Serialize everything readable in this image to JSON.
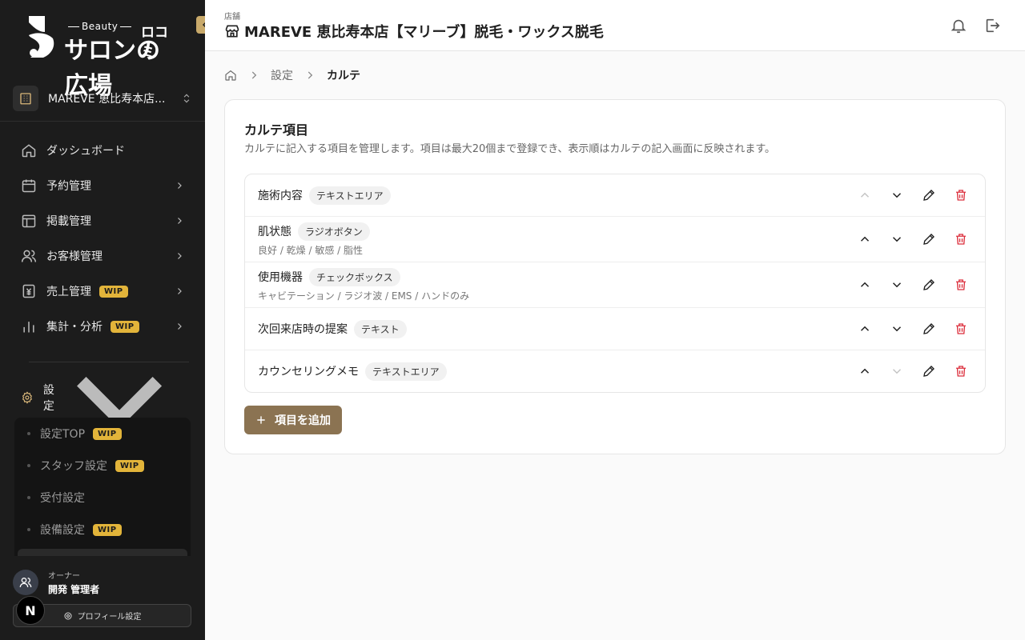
{
  "sidebar": {
    "logo": {
      "beauty": "Beauty",
      "kuchikomi": "ロコミ",
      "name": "サロンの広場"
    },
    "store": {
      "name": "MAREVE 恵比寿本店..."
    },
    "nav": [
      {
        "label": "ダッシュボード",
        "icon": "home-icon",
        "wip": ""
      },
      {
        "label": "予約管理",
        "icon": "calendar-icon",
        "wip": ""
      },
      {
        "label": "掲載管理",
        "icon": "layout-icon",
        "wip": ""
      },
      {
        "label": "お客様管理",
        "icon": "users-icon",
        "wip": ""
      },
      {
        "label": "売上管理",
        "icon": "money-icon",
        "wip": "WIP"
      },
      {
        "label": "集計・分析",
        "icon": "bar-chart-icon",
        "wip": "WIP"
      }
    ],
    "settings": {
      "label": "設定",
      "items": [
        {
          "label": "設定TOP",
          "wip": "WIP"
        },
        {
          "label": "スタッフ設定",
          "wip": "WIP"
        },
        {
          "label": "受付設定",
          "wip": ""
        },
        {
          "label": "設備設定",
          "wip": "WIP"
        }
      ]
    },
    "user": {
      "role": "オーナー",
      "name": "開発 管理者"
    },
    "n_badge": "N",
    "profile_button": "プロフィール設定"
  },
  "header": {
    "label": "店舗",
    "title": "MAREVE 恵比寿本店【マリーブ】脱毛・ワックス脱毛"
  },
  "breadcrumb": {
    "settings": "設定",
    "current": "カルテ"
  },
  "card": {
    "title": "カルテ項目",
    "description": "カルテに記入する項目を管理します。項目は最大20個まで登録でき、表示順はカルテの記入画面に反映されます。",
    "items": [
      {
        "name": "施術内容",
        "type": "テキストエリア",
        "options": "",
        "up_enabled": false,
        "down_enabled": true
      },
      {
        "name": "肌状態",
        "type": "ラジオボタン",
        "options": "良好 / 乾燥 / 敏感 / 脂性",
        "up_enabled": true,
        "down_enabled": true
      },
      {
        "name": "使用機器",
        "type": "チェックボックス",
        "options": "キャビテーション / ラジオ波 / EMS / ハンドのみ",
        "up_enabled": true,
        "down_enabled": true
      },
      {
        "name": "次回来店時の提案",
        "type": "テキスト",
        "options": "",
        "up_enabled": true,
        "down_enabled": true
      },
      {
        "name": "カウンセリングメモ",
        "type": "テキストエリア",
        "options": "",
        "up_enabled": true,
        "down_enabled": false
      }
    ],
    "add_button": "項目を追加"
  },
  "colors": {
    "accent": "#8b7352",
    "wip": "#e2b43a",
    "delete": "#dc2f3c",
    "sidebar": "#1c1c1c"
  }
}
